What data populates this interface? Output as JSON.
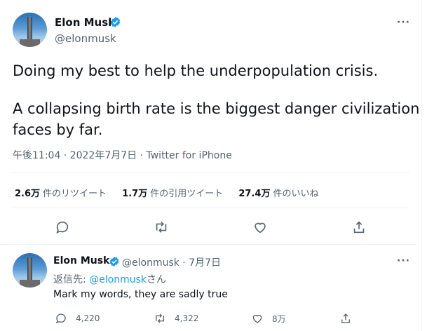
{
  "tweet": {
    "author_name": "Elon Musk",
    "author_handle": "@elonmusk",
    "line1": "Doing my best to help the underpopulation crisis.",
    "line2": "A collapsing birth rate is the biggest danger civilization",
    "line3": "faces by far.",
    "meta": "午後11:04 · 2022年7月7日 · Twitter for iPhone",
    "stats": [
      {
        "num": "2.6万",
        "label": "件のリツイート"
      },
      {
        "num": "1.7万",
        "label": "件の引用ツイート"
      },
      {
        "num": "27.4万",
        "label": "件のいいね"
      }
    ],
    "more": "···"
  },
  "reply": {
    "author_name": "Elon Musk",
    "handle_date": "@elonmusk · 7月7日",
    "replying_prefix": "返信先: ",
    "replying_handle": "@elonmusk",
    "replying_suffix": "さん",
    "text": "Mark my words, they are sadly true",
    "replies": "4,220",
    "retweets": "4,322",
    "likes": "8万",
    "more": "···"
  },
  "colors": {
    "accent": "#1d9bf0",
    "muted": "#536471",
    "text": "#0f1419",
    "divider": "#eff3f4"
  }
}
